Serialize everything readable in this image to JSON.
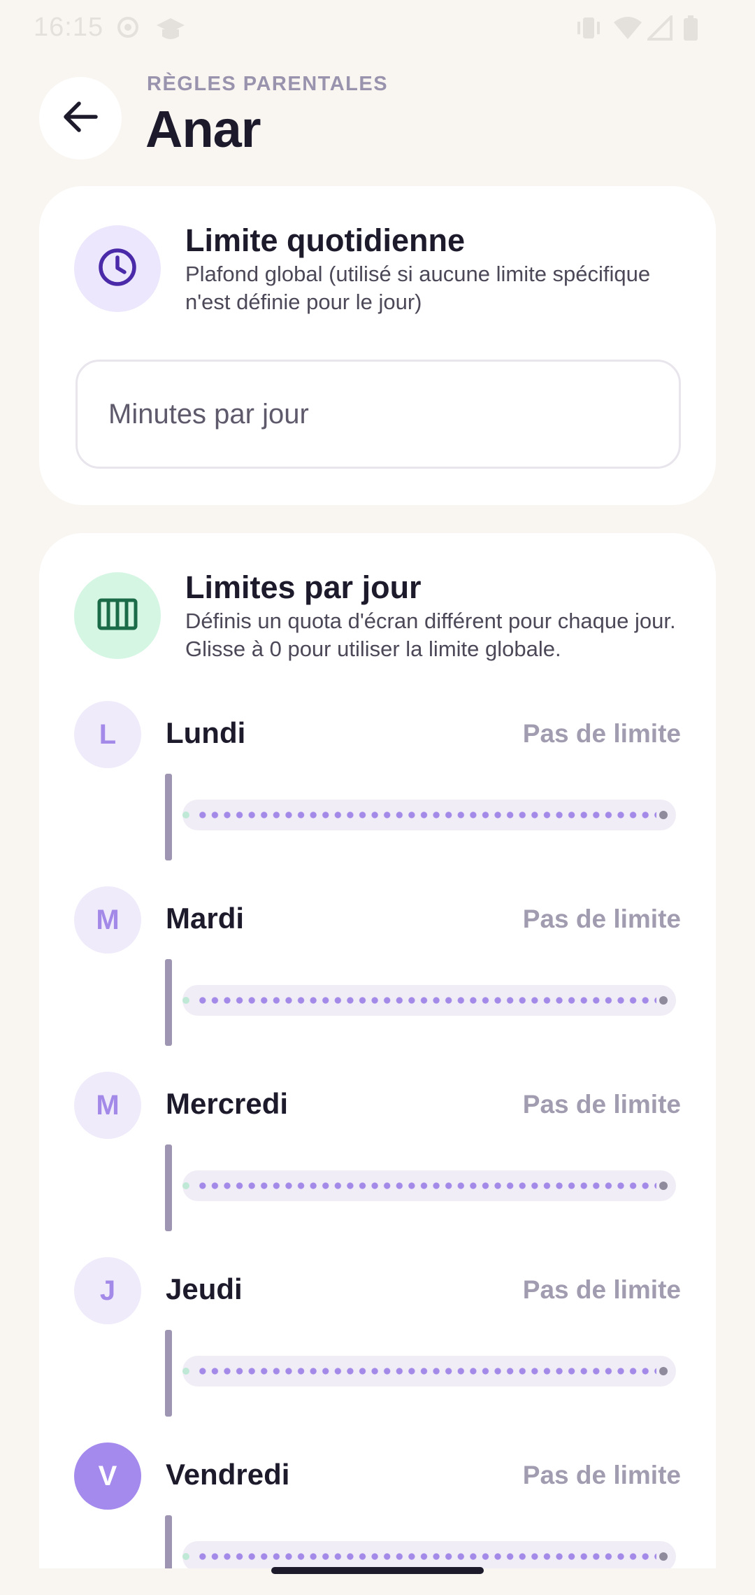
{
  "status_bar": {
    "time": "16:15",
    "left_icons": [
      "sync-icon",
      "mortarboard-icon"
    ],
    "right_icons": [
      "vibrate-icon",
      "wifi-icon",
      "signal-icon",
      "battery-icon"
    ]
  },
  "header": {
    "eyebrow": "RÈGLES PARENTALES",
    "title": "Anar",
    "back_icon": "arrow-left-icon"
  },
  "daily_limit": {
    "icon": "clock-icon",
    "title": "Limite quotidienne",
    "description": "Plafond global (utilisé si aucune limite spécifique n'est définie pour le jour)",
    "input": {
      "value": "",
      "placeholder": "Minutes par jour"
    }
  },
  "per_day": {
    "icon": "calendar-columns-icon",
    "title": "Limites par jour",
    "description": "Définis un quota d'écran différent pour chaque jour. Glisse à 0 pour utiliser la limite globale.",
    "days": [
      {
        "initial": "L",
        "name": "Lundi",
        "limit": "Pas de limite",
        "slider_value": 0
      },
      {
        "initial": "M",
        "name": "Mardi",
        "limit": "Pas de limite",
        "slider_value": 0
      },
      {
        "initial": "M",
        "name": "Mercredi",
        "limit": "Pas de limite",
        "slider_value": 0
      },
      {
        "initial": "J",
        "name": "Jeudi",
        "limit": "Pas de limite",
        "slider_value": 0
      },
      {
        "initial": "V",
        "name": "Vendredi",
        "limit": "Pas de limite",
        "slider_value": 0
      }
    ]
  },
  "colors": {
    "background": "#f9f6f2",
    "card": "#ffffff",
    "accent_purple": "#a48ae8",
    "clock_icon_bg": "#ece7fc",
    "calendar_icon_bg": "#d4f6e3",
    "calendar_icon": "#1b6b48"
  }
}
